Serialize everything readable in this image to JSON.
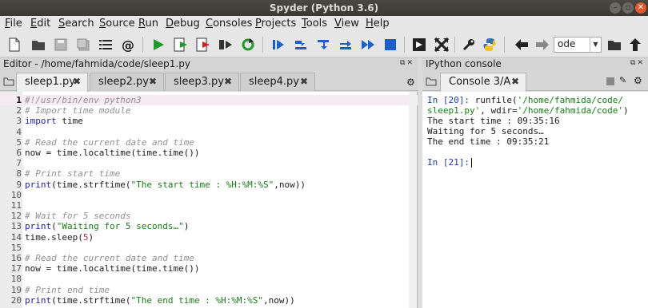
{
  "window": {
    "title": "Spyder (Python 3.6)"
  },
  "menu": [
    "File",
    "Edit",
    "Search",
    "Source",
    "Run",
    "Debug",
    "Consoles",
    "Projects",
    "Tools",
    "View",
    "Help"
  ],
  "toolbar": {
    "working_dir": "ode"
  },
  "editor": {
    "header": "Editor - /home/fahmida/code/sleep1.py",
    "tabs": [
      "sleep1.py",
      "sleep2.py",
      "sleep3.py",
      "sleep4.py"
    ],
    "active_tab": 0,
    "lines": [
      {
        "n": "1",
        "parts": [
          {
            "t": "#!/usr/bin/env python3",
            "c": "cm"
          }
        ]
      },
      {
        "n": "2",
        "parts": [
          {
            "t": "# Import time module",
            "c": "cm"
          }
        ]
      },
      {
        "n": "3",
        "parts": [
          {
            "t": "import",
            "c": "kw"
          },
          {
            "t": " time",
            "c": ""
          }
        ]
      },
      {
        "n": "4",
        "parts": []
      },
      {
        "n": "5",
        "parts": [
          {
            "t": "# Read the current date and time",
            "c": "cm"
          }
        ]
      },
      {
        "n": "6",
        "parts": [
          {
            "t": "now = time.localtime(time.time())",
            "c": ""
          }
        ]
      },
      {
        "n": "7",
        "parts": []
      },
      {
        "n": "8",
        "parts": [
          {
            "t": "# Print start time",
            "c": "cm"
          }
        ]
      },
      {
        "n": "9",
        "parts": [
          {
            "t": "print",
            "c": "kw"
          },
          {
            "t": "(time.strftime(",
            "c": ""
          },
          {
            "t": "\"The start time : %H:%M:%S\"",
            "c": "st"
          },
          {
            "t": ",now))",
            "c": ""
          }
        ]
      },
      {
        "n": "10",
        "parts": []
      },
      {
        "n": "11",
        "parts": []
      },
      {
        "n": "12",
        "parts": [
          {
            "t": "# Wait for 5 seconds",
            "c": "cm"
          }
        ]
      },
      {
        "n": "13",
        "parts": [
          {
            "t": "print",
            "c": "kw"
          },
          {
            "t": "(",
            "c": ""
          },
          {
            "t": "\"Waiting for 5 seconds…\"",
            "c": "st"
          },
          {
            "t": ")",
            "c": ""
          }
        ]
      },
      {
        "n": "14",
        "parts": [
          {
            "t": "time.sleep(",
            "c": ""
          },
          {
            "t": "5",
            "c": "nm"
          },
          {
            "t": ")",
            "c": ""
          }
        ]
      },
      {
        "n": "15",
        "parts": []
      },
      {
        "n": "16",
        "parts": [
          {
            "t": "# Read the current date and time",
            "c": "cm"
          }
        ]
      },
      {
        "n": "17",
        "parts": [
          {
            "t": "now = time.localtime(time.time())",
            "c": ""
          }
        ]
      },
      {
        "n": "18",
        "parts": []
      },
      {
        "n": "19",
        "parts": [
          {
            "t": "# Print end time",
            "c": "cm"
          }
        ]
      },
      {
        "n": "20",
        "parts": [
          {
            "t": "print",
            "c": "kw"
          },
          {
            "t": "(time.strftime(",
            "c": ""
          },
          {
            "t": "\"The end time : %H:%M:%S\"",
            "c": "st"
          },
          {
            "t": ",now))",
            "c": ""
          }
        ]
      }
    ]
  },
  "console": {
    "header": "IPython console",
    "tab": "Console 3/A",
    "prompt1": "In [20]:",
    "cmd_a": " runfile(",
    "cmd_b": "'/home/fahmida/code/",
    "cmd_c": "sleep1.py'",
    "cmd_d": ", wdir=",
    "cmd_e": "'/home/fahmida/code'",
    "cmd_f": ")",
    "out1": "The start time : 09:35:16",
    "out2": "Waiting for 5 seconds…",
    "out3": "The end time : 09:35:21",
    "prompt2": "In [21]:"
  }
}
